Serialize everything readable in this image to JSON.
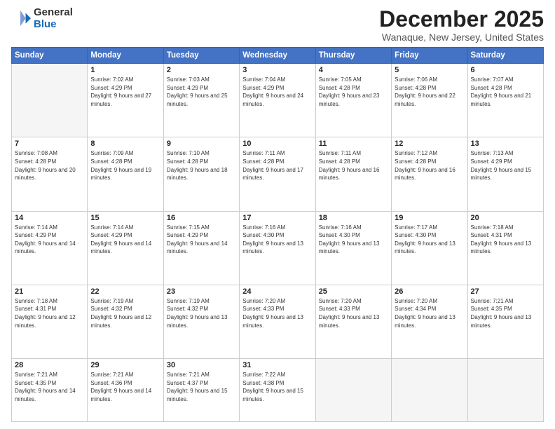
{
  "logo": {
    "general": "General",
    "blue": "Blue"
  },
  "title": "December 2025",
  "subtitle": "Wanaque, New Jersey, United States",
  "days_of_week": [
    "Sunday",
    "Monday",
    "Tuesday",
    "Wednesday",
    "Thursday",
    "Friday",
    "Saturday"
  ],
  "weeks": [
    [
      {
        "day": "",
        "sunrise": "",
        "sunset": "",
        "daylight": ""
      },
      {
        "day": "1",
        "sunrise": "Sunrise: 7:02 AM",
        "sunset": "Sunset: 4:29 PM",
        "daylight": "Daylight: 9 hours and 27 minutes."
      },
      {
        "day": "2",
        "sunrise": "Sunrise: 7:03 AM",
        "sunset": "Sunset: 4:29 PM",
        "daylight": "Daylight: 9 hours and 25 minutes."
      },
      {
        "day": "3",
        "sunrise": "Sunrise: 7:04 AM",
        "sunset": "Sunset: 4:29 PM",
        "daylight": "Daylight: 9 hours and 24 minutes."
      },
      {
        "day": "4",
        "sunrise": "Sunrise: 7:05 AM",
        "sunset": "Sunset: 4:28 PM",
        "daylight": "Daylight: 9 hours and 23 minutes."
      },
      {
        "day": "5",
        "sunrise": "Sunrise: 7:06 AM",
        "sunset": "Sunset: 4:28 PM",
        "daylight": "Daylight: 9 hours and 22 minutes."
      },
      {
        "day": "6",
        "sunrise": "Sunrise: 7:07 AM",
        "sunset": "Sunset: 4:28 PM",
        "daylight": "Daylight: 9 hours and 21 minutes."
      }
    ],
    [
      {
        "day": "7",
        "sunrise": "Sunrise: 7:08 AM",
        "sunset": "Sunset: 4:28 PM",
        "daylight": "Daylight: 9 hours and 20 minutes."
      },
      {
        "day": "8",
        "sunrise": "Sunrise: 7:09 AM",
        "sunset": "Sunset: 4:28 PM",
        "daylight": "Daylight: 9 hours and 19 minutes."
      },
      {
        "day": "9",
        "sunrise": "Sunrise: 7:10 AM",
        "sunset": "Sunset: 4:28 PM",
        "daylight": "Daylight: 9 hours and 18 minutes."
      },
      {
        "day": "10",
        "sunrise": "Sunrise: 7:11 AM",
        "sunset": "Sunset: 4:28 PM",
        "daylight": "Daylight: 9 hours and 17 minutes."
      },
      {
        "day": "11",
        "sunrise": "Sunrise: 7:11 AM",
        "sunset": "Sunset: 4:28 PM",
        "daylight": "Daylight: 9 hours and 16 minutes."
      },
      {
        "day": "12",
        "sunrise": "Sunrise: 7:12 AM",
        "sunset": "Sunset: 4:28 PM",
        "daylight": "Daylight: 9 hours and 16 minutes."
      },
      {
        "day": "13",
        "sunrise": "Sunrise: 7:13 AM",
        "sunset": "Sunset: 4:29 PM",
        "daylight": "Daylight: 9 hours and 15 minutes."
      }
    ],
    [
      {
        "day": "14",
        "sunrise": "Sunrise: 7:14 AM",
        "sunset": "Sunset: 4:29 PM",
        "daylight": "Daylight: 9 hours and 14 minutes."
      },
      {
        "day": "15",
        "sunrise": "Sunrise: 7:14 AM",
        "sunset": "Sunset: 4:29 PM",
        "daylight": "Daylight: 9 hours and 14 minutes."
      },
      {
        "day": "16",
        "sunrise": "Sunrise: 7:15 AM",
        "sunset": "Sunset: 4:29 PM",
        "daylight": "Daylight: 9 hours and 14 minutes."
      },
      {
        "day": "17",
        "sunrise": "Sunrise: 7:16 AM",
        "sunset": "Sunset: 4:30 PM",
        "daylight": "Daylight: 9 hours and 13 minutes."
      },
      {
        "day": "18",
        "sunrise": "Sunrise: 7:16 AM",
        "sunset": "Sunset: 4:30 PM",
        "daylight": "Daylight: 9 hours and 13 minutes."
      },
      {
        "day": "19",
        "sunrise": "Sunrise: 7:17 AM",
        "sunset": "Sunset: 4:30 PM",
        "daylight": "Daylight: 9 hours and 13 minutes."
      },
      {
        "day": "20",
        "sunrise": "Sunrise: 7:18 AM",
        "sunset": "Sunset: 4:31 PM",
        "daylight": "Daylight: 9 hours and 13 minutes."
      }
    ],
    [
      {
        "day": "21",
        "sunrise": "Sunrise: 7:18 AM",
        "sunset": "Sunset: 4:31 PM",
        "daylight": "Daylight: 9 hours and 12 minutes."
      },
      {
        "day": "22",
        "sunrise": "Sunrise: 7:19 AM",
        "sunset": "Sunset: 4:32 PM",
        "daylight": "Daylight: 9 hours and 12 minutes."
      },
      {
        "day": "23",
        "sunrise": "Sunrise: 7:19 AM",
        "sunset": "Sunset: 4:32 PM",
        "daylight": "Daylight: 9 hours and 13 minutes."
      },
      {
        "day": "24",
        "sunrise": "Sunrise: 7:20 AM",
        "sunset": "Sunset: 4:33 PM",
        "daylight": "Daylight: 9 hours and 13 minutes."
      },
      {
        "day": "25",
        "sunrise": "Sunrise: 7:20 AM",
        "sunset": "Sunset: 4:33 PM",
        "daylight": "Daylight: 9 hours and 13 minutes."
      },
      {
        "day": "26",
        "sunrise": "Sunrise: 7:20 AM",
        "sunset": "Sunset: 4:34 PM",
        "daylight": "Daylight: 9 hours and 13 minutes."
      },
      {
        "day": "27",
        "sunrise": "Sunrise: 7:21 AM",
        "sunset": "Sunset: 4:35 PM",
        "daylight": "Daylight: 9 hours and 13 minutes."
      }
    ],
    [
      {
        "day": "28",
        "sunrise": "Sunrise: 7:21 AM",
        "sunset": "Sunset: 4:35 PM",
        "daylight": "Daylight: 9 hours and 14 minutes."
      },
      {
        "day": "29",
        "sunrise": "Sunrise: 7:21 AM",
        "sunset": "Sunset: 4:36 PM",
        "daylight": "Daylight: 9 hours and 14 minutes."
      },
      {
        "day": "30",
        "sunrise": "Sunrise: 7:21 AM",
        "sunset": "Sunset: 4:37 PM",
        "daylight": "Daylight: 9 hours and 15 minutes."
      },
      {
        "day": "31",
        "sunrise": "Sunrise: 7:22 AM",
        "sunset": "Sunset: 4:38 PM",
        "daylight": "Daylight: 9 hours and 15 minutes."
      },
      {
        "day": "",
        "sunrise": "",
        "sunset": "",
        "daylight": ""
      },
      {
        "day": "",
        "sunrise": "",
        "sunset": "",
        "daylight": ""
      },
      {
        "day": "",
        "sunrise": "",
        "sunset": "",
        "daylight": ""
      }
    ]
  ]
}
